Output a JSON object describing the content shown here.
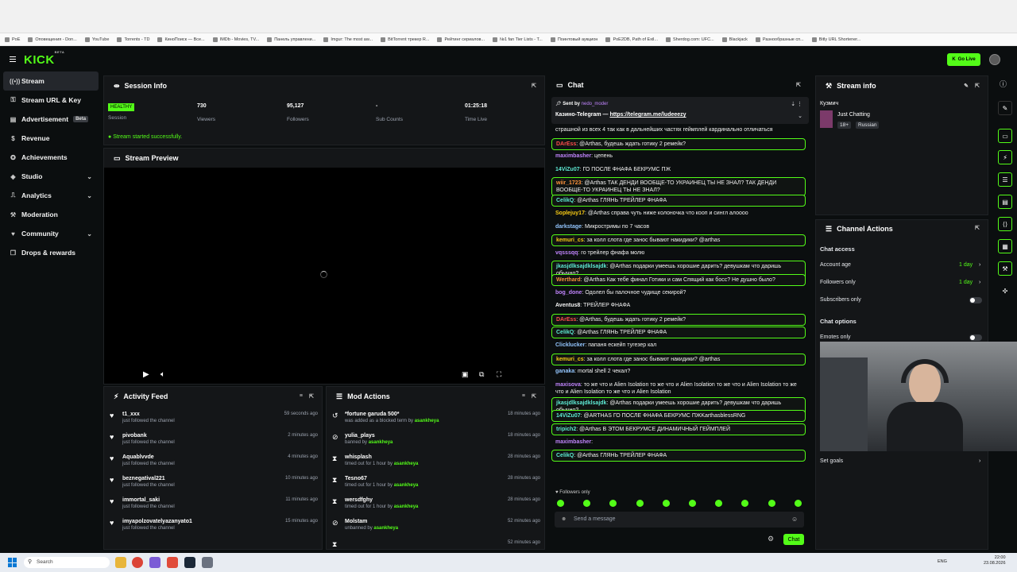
{
  "bookmarks": [
    "PoE",
    "Оповещения - Don...",
    "YouTube",
    "Torrents - TD",
    "КиноПоиск — Все...",
    "IMDb - Movies, TV...",
    "Панель управлени...",
    "Imgur: The most aw...",
    "BitTorrent трекер R...",
    "Рейтинг сериалов...",
    "№1 fan Tier Lists - T...",
    "Поинтовый аукцион",
    "PoE2DB, Path of Exil...",
    "Sherdog.com: UFC...",
    "Blackjack",
    "Разнообразные сп...",
    "Bitly URL Shortener..."
  ],
  "app": {
    "logo": "KICK",
    "logo_sup": "BETA",
    "go_live": "Go Live"
  },
  "sidebar": {
    "items": [
      {
        "label": "Stream",
        "icon": "stream-icon"
      },
      {
        "label": "Stream URL & Key",
        "icon": "key-icon"
      },
      {
        "label": "Advertisement",
        "badge": "Beta",
        "icon": "ad-icon"
      },
      {
        "label": "Revenue",
        "icon": "dollar-icon"
      },
      {
        "label": "Achievements",
        "icon": "trophy-icon"
      },
      {
        "label": "Studio",
        "icon": "studio-icon"
      },
      {
        "label": "Analytics",
        "icon": "analytics-icon"
      },
      {
        "label": "Moderation",
        "icon": "shield-icon"
      },
      {
        "label": "Community",
        "icon": "community-icon"
      },
      {
        "label": "Drops & rewards",
        "icon": "gift-icon"
      }
    ]
  },
  "session": {
    "title": "Session Info",
    "status": "HEALTHY",
    "status_label": "Session",
    "viewers": "730",
    "viewers_label": "Viewers",
    "followers": "95,127",
    "followers_label": "Followers",
    "subs": "-",
    "subs_label": "Sub Counts",
    "time": "01:25:18",
    "time_label": "Time Live",
    "message": "Stream started successfully."
  },
  "preview": {
    "title": "Stream Preview"
  },
  "activity": {
    "title": "Activity Feed",
    "items": [
      {
        "name": "t1_xxx",
        "sub": "just followed the channel",
        "time": "59 seconds ago"
      },
      {
        "name": "pivobank",
        "sub": "just followed the channel",
        "time": "2 minutes ago"
      },
      {
        "name": "Aquablvvde",
        "sub": "just followed the channel",
        "time": "4 minutes ago"
      },
      {
        "name": "beznegatival221",
        "sub": "just followed the channel",
        "time": "10 minutes ago"
      },
      {
        "name": "immortal_saki",
        "sub": "just followed the channel",
        "time": "11 minutes ago"
      },
      {
        "name": "imyapolzovatelyazanyato1",
        "sub": "just followed the channel",
        "time": "15 minutes ago"
      }
    ]
  },
  "mod": {
    "title": "Mod Actions",
    "items": [
      {
        "name": "*fortune garuda 500*",
        "sub": "was added as a blocked term by ",
        "by": "asankheya",
        "time": "18 minutes ago"
      },
      {
        "name": "yulia_plays",
        "sub": "banned by ",
        "by": "asankheya",
        "time": "18 minutes ago"
      },
      {
        "name": "whisplash",
        "sub": "timed out for 1 hour by ",
        "by": "asankheya",
        "time": "28 minutes ago"
      },
      {
        "name": "Tesno67",
        "sub": "timed out for 1 hour by ",
        "by": "asankheya",
        "time": "28 minutes ago"
      },
      {
        "name": "wersdfghy",
        "sub": "timed out for 1 hour by ",
        "by": "asankheya",
        "time": "28 minutes ago"
      },
      {
        "name": "Molstam",
        "sub": "unbanned by ",
        "by": "asankheya",
        "time": "52 minutes ago"
      },
      {
        "name": "",
        "sub": "",
        "by": "",
        "time": "52 minutes ago"
      }
    ]
  },
  "chat": {
    "title": "Chat",
    "pinned_sent_by": "Sent by",
    "pinned_user": "nedo_moder",
    "pinned_text": "Казино-Telegram — ",
    "pinned_link": "https://telegram.me/ludeeezy",
    "messages": [
      {
        "user": "",
        "color": "#f3f3f3",
        "text": "страшной из всех 4 так как в дальнейших частях геймплей кардинально отличаться",
        "hl": false
      },
      {
        "user": "DArEss",
        "color": "#ff4d4d",
        "text": ": @Arthas, будешь ждать готику 2 ремейк?",
        "hl": true
      },
      {
        "user": "maximbasher",
        "color": "#c084fc",
        "text": ": цепень",
        "hl": false
      },
      {
        "user": "14ViZu07",
        "color": "#5eead4",
        "text": ": ГО ПОСЛЕ ФНАФА БЕКРУМС ПЖ",
        "hl": false
      },
      {
        "user": "wiir_1723",
        "color": "#fb923c",
        "text": ": @Arthas ТАК ДЕНДИ ВООБЩЕ-ТО УКРАИНЕЦ ТЫ НЕ ЗНАЛ? ТАК ДЕНДИ ВООБЩЕ-ТО УКРАИНЕЦ ТЫ НЕ ЗНАЛ?",
        "hl": true
      },
      {
        "user": "CelikQ",
        "color": "#5eead4",
        "text": ": @Arthas ГЛЯНЬ ТРЕЙЛЕР ФНАФА",
        "hl": true
      },
      {
        "user": "Soplejuy17",
        "color": "#facc15",
        "text": ": @Arthas справа чуть ниже колоночка что кооп и сингл алоооо",
        "hl": false
      },
      {
        "user": "darkstage",
        "color": "#93c5fd",
        "text": ": Микростримы по 7 часов",
        "hl": false
      },
      {
        "user": "kemuri_cs",
        "color": "#facc15",
        "text": ": за колл слота где занос бывают накидики? @arthas",
        "hl": true
      },
      {
        "user": "vqsssqq",
        "color": "#c084fc",
        "text": ": го трейлер фнафа молю",
        "hl": false
      },
      {
        "user": "jkasjdlksajdklsajdk",
        "color": "#5eead4",
        "text": ": @Arthas подарки умеешь хорошие дарить? девушкам что даришь обычно?",
        "hl": true
      },
      {
        "user": "Werthard",
        "color": "#fb923c",
        "text": ": @Arthas Как тебе финал Готики и сам Спящий как босс? Не душно было?",
        "hl": true
      },
      {
        "user": "bog_done",
        "color": "#c084fc",
        "text": ": Одолел бы палочное чудище секирой?",
        "hl": false
      },
      {
        "user": "Aventus8",
        "color": "#f3f3f3",
        "text": ": ТРЕЙЛЕР ФНАФА",
        "hl": false
      },
      {
        "user": "DArEss",
        "color": "#ff4d4d",
        "text": ": @Arthas, будешь ждать готику 2 ремейк?",
        "hl": true
      },
      {
        "user": "CelikQ",
        "color": "#5eead4",
        "text": ": @Arthas ГЛЯНЬ ТРЕЙЛЕР ФНАФА",
        "hl": true
      },
      {
        "user": "Clicklucker",
        "color": "#93c5fd",
        "text": ": папаня ескейп тугезер кал",
        "hl": false
      },
      {
        "user": "kemuri_cs",
        "color": "#facc15",
        "text": ": за колл слота где занос бывают накидики? @arthas",
        "hl": true
      },
      {
        "user": "ganaka",
        "color": "#93c5fd",
        "text": ": mortal shell 2 чекал?",
        "hl": false
      },
      {
        "user": "maxisova",
        "color": "#c084fc",
        "text": ": то же что и Alien Isolation то же что и Alien Isolation то же что и Alien Isolation то же что и Alien Isolation то же что и Alien Isolation",
        "hl": false
      },
      {
        "user": "jkasjdlksajdklsajdk",
        "color": "#5eead4",
        "text": ": @Arthas подарки умеешь хорошие дарить? девушкам что даришь обычно?",
        "hl": true
      },
      {
        "user": "14ViZu07",
        "color": "#5eead4",
        "text": ": @ARTHAS ГО ПОСЛЕ ФНАФА БЕКРУМС ПЖKarthasblessRNG",
        "hl": true
      },
      {
        "user": "tripich2",
        "color": "#5eead4",
        "text": ": @Arthas В ЭТОМ БЕКРУМСЕ ДИНАМИЧНЫЙ ГЕЙМПЛЕЙ",
        "hl": true
      },
      {
        "user": "maximbasher",
        "color": "#c084fc",
        "text": ":",
        "hl": false
      },
      {
        "user": "CelikQ",
        "color": "#5eead4",
        "text": ": @Arthas ГЛЯНЬ ТРЕЙЛЕР ФНАФА",
        "hl": true
      }
    ],
    "followers_only": "Followers only",
    "input_placeholder": "Send a message",
    "send_label": "Chat"
  },
  "streaminfo": {
    "title": "Stream info",
    "streamer": "Кузмич",
    "category": "Just Chatting",
    "age": "18+",
    "language": "Russian"
  },
  "channel_actions": {
    "title": "Channel Actions",
    "chat_access": "Chat access",
    "account_age": "Account age",
    "account_age_val": "1 day",
    "followers_only": "Followers only",
    "followers_only_val": "1 day",
    "subscribers_only": "Subscribers only",
    "chat_options": "Chat options",
    "emotes_only": "Emotes only",
    "set_goals": "Set goals"
  },
  "taskbar": {
    "search": "Search",
    "lang": "ENG",
    "time": "22:00",
    "date": "23.08.2026"
  },
  "colors": {
    "accent": "#53fc18",
    "bg": "#0b0e0f",
    "panel": "#141618"
  }
}
